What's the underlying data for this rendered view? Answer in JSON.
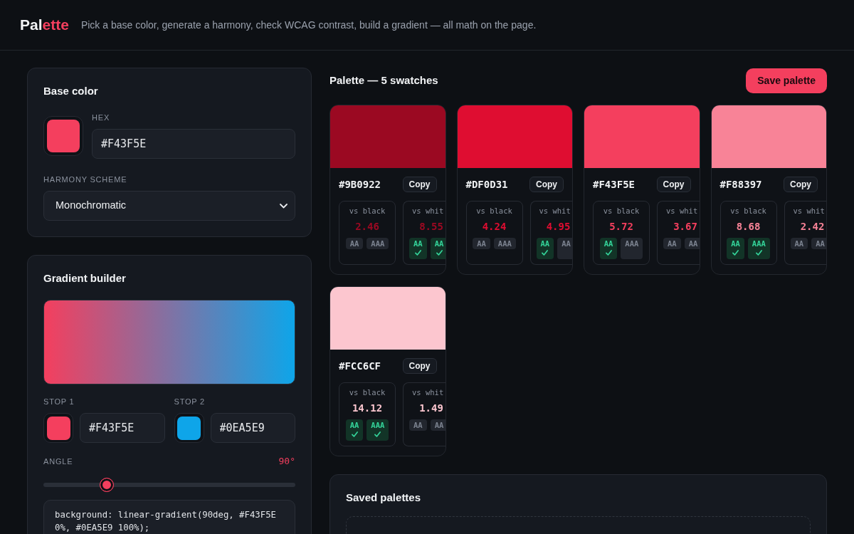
{
  "header": {
    "logo": {
      "lead": "Pal",
      "accent": "ette"
    },
    "tagline": "Pick a base color, generate a harmony, check WCAG contrast, build a gradient — all math on the page."
  },
  "base_color": {
    "title": "Base color",
    "color": "#f43f5e",
    "hex_label": "HEX",
    "hex_value": "#F43F5E",
    "harmony_label": "HARMONY SCHEME",
    "harmony_value": "Monochromatic"
  },
  "gradient": {
    "title": "Gradient builder",
    "stops": [
      {
        "label": "STOP 1",
        "color": "#f43f5e",
        "hex": "#F43F5E"
      },
      {
        "label": "STOP 2",
        "color": "#0ea5e9",
        "hex": "#0EA5E9"
      }
    ],
    "angle": {
      "label": "ANGLE",
      "reading": "90°",
      "level": 0.25
    },
    "css": "background: linear-gradient(90deg, #F43F5E 0%, #0EA5E9 100%);"
  },
  "palette": {
    "title": "Palette — 5 swatches",
    "save_button": "Save palette",
    "swatches": [
      {
        "color": "#9b0922",
        "hex": "#9B0922",
        "copy_button": "Copy",
        "contrasts": [
          {
            "kind": "whole",
            "label": "vs black",
            "ratio": "2.46",
            "badges": [
              {
                "label": "AA",
                "pass": false
              },
              {
                "label": "AAA",
                "pass": false
              }
            ]
          },
          {
            "kind": "clipped",
            "label": "vs whit",
            "ratio": "8.55",
            "badges": [
              {
                "label": "AA",
                "pass": true
              },
              {
                "label": "AA",
                "pass": true
              }
            ]
          }
        ]
      },
      {
        "color": "#df0d31",
        "hex": "#DF0D31",
        "copy_button": "Copy",
        "contrasts": [
          {
            "kind": "whole",
            "label": "vs black",
            "ratio": "4.24",
            "badges": [
              {
                "label": "AA",
                "pass": false
              },
              {
                "label": "AAA",
                "pass": false
              }
            ]
          },
          {
            "kind": "clipped",
            "label": "vs whit",
            "ratio": "4.95",
            "badges": [
              {
                "label": "AA",
                "pass": true
              },
              {
                "label": "AA",
                "pass": false
              }
            ]
          }
        ]
      },
      {
        "color": "#f43f5e",
        "hex": "#F43F5E",
        "copy_button": "Copy",
        "contrasts": [
          {
            "kind": "whole",
            "label": "vs black",
            "ratio": "5.72",
            "badges": [
              {
                "label": "AA",
                "pass": true
              },
              {
                "label": "AAA",
                "pass": false
              }
            ]
          },
          {
            "kind": "clipped",
            "label": "vs whit",
            "ratio": "3.67",
            "badges": [
              {
                "label": "AA",
                "pass": false
              },
              {
                "label": "AA",
                "pass": false
              }
            ]
          }
        ]
      },
      {
        "color": "#f88397",
        "hex": "#F88397",
        "copy_button": "Copy",
        "contrasts": [
          {
            "kind": "whole",
            "label": "vs black",
            "ratio": "8.68",
            "badges": [
              {
                "label": "AA",
                "pass": true
              },
              {
                "label": "AAA",
                "pass": true
              }
            ]
          },
          {
            "kind": "clipped",
            "label": "vs whit",
            "ratio": "2.42",
            "badges": [
              {
                "label": "AA",
                "pass": false
              },
              {
                "label": "AA",
                "pass": false
              }
            ]
          }
        ]
      },
      {
        "color": "#fcc6cf",
        "hex": "#FCC6CF",
        "copy_button": "Copy",
        "contrasts": [
          {
            "kind": "whole",
            "label": "vs black",
            "ratio": "14.12",
            "badges": [
              {
                "label": "AA",
                "pass": true
              },
              {
                "label": "AAA",
                "pass": true
              }
            ]
          },
          {
            "kind": "clipped",
            "label": "vs whit",
            "ratio": "1.49",
            "badges": [
              {
                "label": "AA",
                "pass": false
              },
              {
                "label": "AA",
                "pass": false
              }
            ]
          }
        ]
      }
    ]
  },
  "saved": {
    "title": "Saved palettes"
  }
}
